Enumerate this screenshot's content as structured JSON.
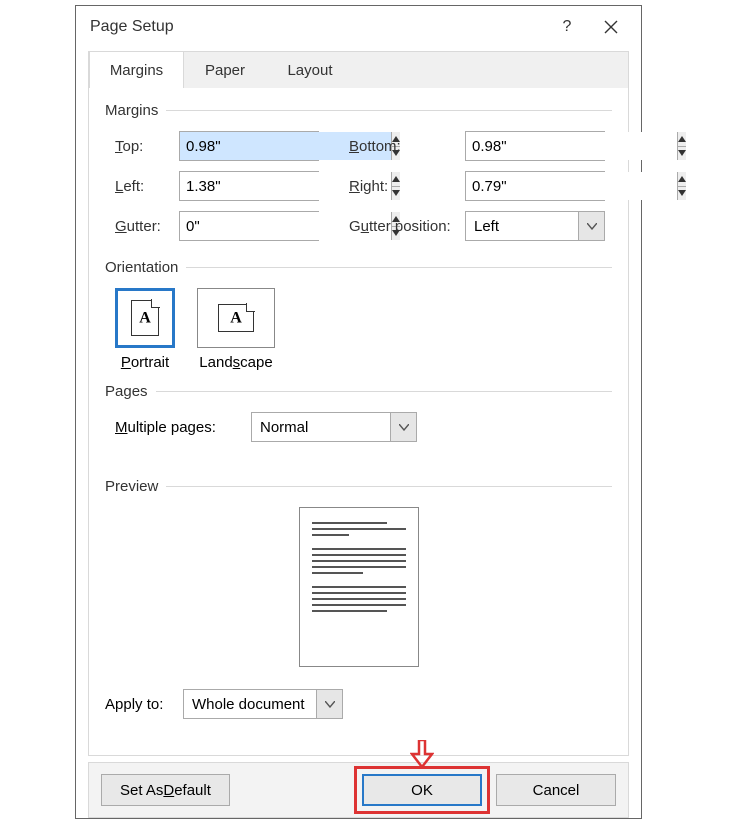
{
  "title": "Page Setup",
  "tabs": {
    "margins": "Margins",
    "paper": "Paper",
    "layout": "Layout"
  },
  "groups": {
    "margins": "Margins",
    "orientation": "Orientation",
    "pages": "Pages",
    "preview": "Preview"
  },
  "margins": {
    "top_label": "op:",
    "top_value": "0.98\"",
    "bottom_label": "ottom:",
    "bottom_value": "0.98\"",
    "left_label": "eft:",
    "left_value": "1.38\"",
    "right_label": "ight:",
    "right_value": "0.79\"",
    "gutter_label": "utter:",
    "gutter_value": "0\"",
    "gutterpos_label": "tter position:",
    "gutterpos_value": "Left"
  },
  "orientation": {
    "portrait": "ortrait",
    "landscape": "cape",
    "landscape_pre": "Land"
  },
  "pages": {
    "label": "ultiple pages:",
    "value": "Normal"
  },
  "apply": {
    "label": "Apply to:",
    "value": "Whole document"
  },
  "footer": {
    "default_pre": "Set As ",
    "default_u": "D",
    "default_post": "efault",
    "ok": "OK",
    "cancel": "Cancel"
  },
  "underline": {
    "T": "T",
    "B": "B",
    "L": "L",
    "R": "R",
    "G": "G",
    "u": "u",
    "P": "P",
    "s": "s",
    "M": "M"
  }
}
